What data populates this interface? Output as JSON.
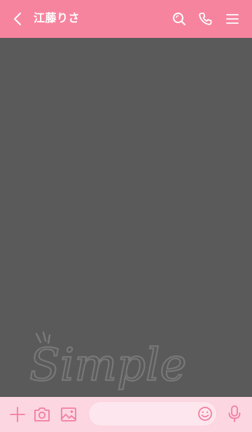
{
  "header": {
    "title": "江藤りさ",
    "icons": [
      "back-arrow-icon",
      "search-icon",
      "phone-icon",
      "menu-icon"
    ]
  },
  "chat": {
    "watermark_text": "Simple"
  },
  "footer": {
    "message_placeholder": "",
    "icons": [
      "plus-icon",
      "camera-icon",
      "image-icon",
      "emoji-icon",
      "microphone-icon"
    ]
  },
  "colors": {
    "header_bg": "#f7849f",
    "chat_bg": "#5a5a5a",
    "footer_bg": "#fcd6e1",
    "footer_icon": "#f27da0"
  }
}
